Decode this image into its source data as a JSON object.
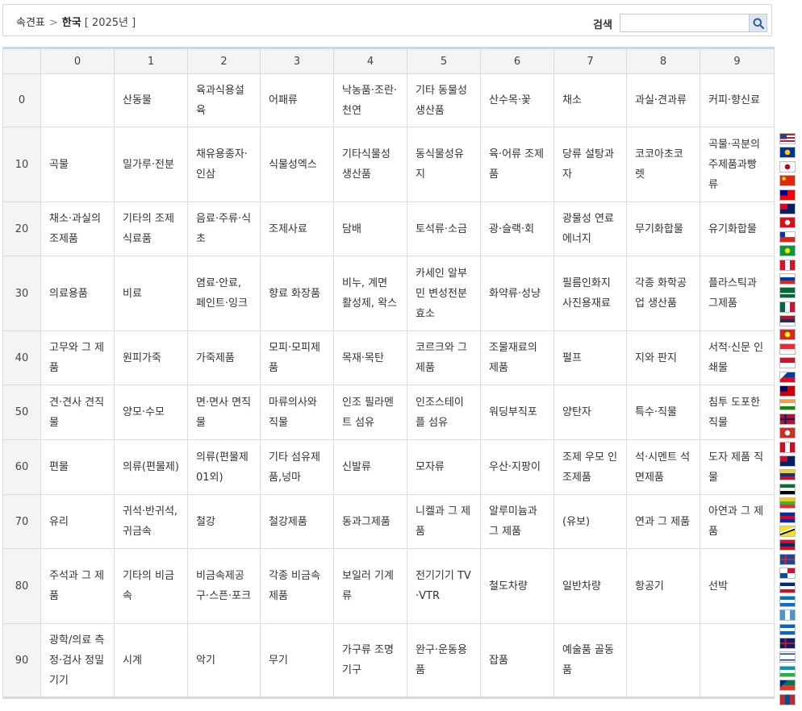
{
  "breadcrumb": {
    "root": "속견표",
    "separator": ">",
    "country": "한국",
    "year": "[ 2025년 ]"
  },
  "search": {
    "label": "검색",
    "value": "",
    "placeholder": ""
  },
  "table": {
    "columns": [
      "0",
      "1",
      "2",
      "3",
      "4",
      "5",
      "6",
      "7",
      "8",
      "9"
    ],
    "rows": [
      {
        "label": "0",
        "cells": [
          "",
          "산동물",
          "육과식용설육",
          "어패류",
          "낙농품·조란·천연",
          "기타 동물성 생산품",
          "산수목·꽃",
          "채소",
          "과실·견과류",
          "커피·향신료"
        ]
      },
      {
        "label": "10",
        "cells": [
          "곡물",
          "밀가루·전분",
          "채유용종자·인삼",
          "식물성엑스",
          "기타식물성 생산품",
          "동식물성유지",
          "육·어류 조제품",
          "당류 설탕과자",
          "코코아초코렛",
          "곡물·곡분의 주제품과빵류"
        ]
      },
      {
        "label": "20",
        "cells": [
          "채소·과실의 조제품",
          "기타의 조제 식료품",
          "음료·주류·식초",
          "조제사료",
          "담배",
          "토석류·소금",
          "광·슬랙·회",
          "광물성 연료 에너지",
          "무기화합물",
          "유기화합물"
        ]
      },
      {
        "label": "30",
        "cells": [
          "의료용품",
          "비료",
          "염료·안료, 페인트·잉크",
          "향료 화장품",
          "비누, 계면 활성제, 왁스",
          "카세인 알부민 변성전분 효소",
          "화약류·성냥",
          "필름인화지 사진용재료",
          "각종 화학공업 생산품",
          "플라스틱과 그제품"
        ]
      },
      {
        "label": "40",
        "cells": [
          "고무와 그 제품",
          "원피가죽",
          "가죽제품",
          "모피·모피제품",
          "목재·목탄",
          "코르크와 그 제품",
          "조물재료의 제품",
          "펄프",
          "지와 판지",
          "서적·신문 인쇄물"
        ]
      },
      {
        "label": "50",
        "cells": [
          "견·견사 견직물",
          "양모·수모",
          "면·면사 면직물",
          "마류의사와 직물",
          "인조 필라멘트 섬유",
          "인조스테이플 섬유",
          "워딩부직포",
          "양탄자",
          "특수·직물",
          "침투 도포한 직물"
        ]
      },
      {
        "label": "60",
        "cells": [
          "편물",
          "의류(편물제)",
          "의류(편물제01외)",
          "기타 섬유제품,넝마",
          "신발류",
          "모자류",
          "우산·지팡이",
          "조제 우모 인조제품",
          "석·시멘트 석면제품",
          "도자 제품 직물"
        ]
      },
      {
        "label": "70",
        "cells": [
          "유리",
          "귀석·반귀석,귀금속",
          "철강",
          "철강제품",
          "동과그제품",
          "니켈과 그 제품",
          "알루미늄과 그 제품",
          "(유보)",
          "연과 그 제품",
          "아연과 그 제품"
        ]
      },
      {
        "label": "80",
        "cells": [
          "주석과 그 제품",
          "기타의 비금속",
          "비금속제공구·스픈·포크",
          "각종 비금속제품",
          "보일러 기계류",
          "전기기기 TV·VTR",
          "철도차량",
          "일반차량",
          "항공기",
          "선박"
        ]
      },
      {
        "label": "90",
        "cells": [
          "광학/의료 측정·검사 정밀기기",
          "시계",
          "악기",
          "무기",
          "가구류 조명기구",
          "완구·운동용품",
          "잡품",
          "예술품 골동품",
          "",
          ""
        ]
      }
    ]
  },
  "flags": [
    {
      "name": "us-flag",
      "c1": "#b22234",
      "c2": "#ffffff",
      "c3": "#3c3b6e",
      "pat": "us"
    },
    {
      "name": "eu-flag",
      "c1": "#003399",
      "c2": "#003399",
      "c3": "#ffcc00",
      "pat": "dot"
    },
    {
      "name": "jp-flag",
      "c1": "#ffffff",
      "c2": "#ffffff",
      "c3": "#bc002d",
      "pat": "dot"
    },
    {
      "name": "cn-flag",
      "c1": "#de2910",
      "c2": "#de2910",
      "c3": "#ffde00",
      "pat": "corner"
    },
    {
      "name": "tw-flag",
      "c1": "#fe0000",
      "c2": "#fe0000",
      "c3": "#000095",
      "pat": "canton"
    },
    {
      "name": "au-flag",
      "c1": "#012169",
      "c2": "#012169",
      "c3": "#e4002b",
      "pat": "canton"
    },
    {
      "name": "tr-flag",
      "c1": "#e30a17",
      "c2": "#e30a17",
      "c3": "#ffffff",
      "pat": "dot"
    },
    {
      "name": "cl-flag",
      "c1": "#ffffff",
      "c2": "#d52b1e",
      "c3": "#0039a6",
      "pat": "hcanton"
    },
    {
      "name": "br-flag",
      "c1": "#009c3b",
      "c2": "#009c3b",
      "c3": "#ffdf00",
      "pat": "dot"
    },
    {
      "name": "pe-flag",
      "c1": "#d91023",
      "c2": "#ffffff",
      "c3": "#d91023",
      "pat": "v3"
    },
    {
      "name": "ru-flag",
      "c1": "#ffffff",
      "c2": "#0039a6",
      "c3": "#d52b1e",
      "pat": "h3"
    },
    {
      "name": "sa-flag",
      "c1": "#006c35",
      "c2": "#006c35",
      "c3": "#ffffff",
      "pat": "bar"
    },
    {
      "name": "mx-flag",
      "c1": "#006847",
      "c2": "#ffffff",
      "c3": "#ce1126",
      "pat": "v3"
    },
    {
      "name": "th-flag",
      "c1": "#a51931",
      "c2": "#2d2a4a",
      "c3": "#f4f5f8",
      "pat": "h3"
    },
    {
      "name": "vn-flag",
      "c1": "#da251d",
      "c2": "#da251d",
      "c3": "#ffff00",
      "pat": "dot"
    },
    {
      "name": "sg-flag",
      "c1": "#ed2939",
      "c2": "#ffffff",
      "c3": "#ffffff",
      "pat": "h2"
    },
    {
      "name": "id-flag",
      "c1": "#ce1126",
      "c2": "#ffffff",
      "c3": "#ffffff",
      "pat": "h2"
    },
    {
      "name": "ph-flag",
      "c1": "#0038a8",
      "c2": "#ce1126",
      "c3": "#ffffff",
      "pat": "tri"
    },
    {
      "name": "my-flag",
      "c1": "#cc0001",
      "c2": "#ffffff",
      "c3": "#010066",
      "pat": "canton"
    },
    {
      "name": "in-flag",
      "c1": "#ff9933",
      "c2": "#ffffff",
      "c3": "#138808",
      "pat": "h3"
    },
    {
      "name": "no-flag",
      "c1": "#ba0c2f",
      "c2": "#ba0c2f",
      "c3": "#00205b",
      "pat": "cross"
    },
    {
      "name": "ch-flag",
      "c1": "#d52b1e",
      "c2": "#d52b1e",
      "c3": "#ffffff",
      "pat": "dot"
    },
    {
      "name": "ca-flag",
      "c1": "#d80621",
      "c2": "#ffffff",
      "c3": "#d80621",
      "pat": "v3"
    },
    {
      "name": "nz-flag",
      "c1": "#012169",
      "c2": "#012169",
      "c3": "#c8102e",
      "pat": "canton"
    },
    {
      "name": "co-flag",
      "c1": "#fcd116",
      "c2": "#003893",
      "c3": "#ce1126",
      "pat": "h3"
    },
    {
      "name": "ae-flag",
      "c1": "#00732f",
      "c2": "#ffffff",
      "c3": "#000000",
      "pat": "h3"
    },
    {
      "name": "mm-flag",
      "c1": "#fecb00",
      "c2": "#34b233",
      "c3": "#ea2839",
      "pat": "h3"
    },
    {
      "name": "kh-flag",
      "c1": "#032ea1",
      "c2": "#e00025",
      "c3": "#032ea1",
      "pat": "h3"
    },
    {
      "name": "bn-flag",
      "c1": "#f7e017",
      "c2": "#ffffff",
      "c3": "#000000",
      "pat": "diag"
    },
    {
      "name": "la-flag",
      "c1": "#ce1126",
      "c2": "#002868",
      "c3": "#ce1126",
      "pat": "h3"
    },
    {
      "name": "is-flag",
      "c1": "#02529c",
      "c2": "#02529c",
      "c3": "#dc1e35",
      "pat": "cross"
    },
    {
      "name": "pa-flag",
      "c1": "#ffffff",
      "c2": "#d21034",
      "c3": "#005293",
      "pat": "quad"
    },
    {
      "name": "cr-flag",
      "c1": "#002b7f",
      "c2": "#ffffff",
      "c3": "#ce1126",
      "pat": "h3"
    },
    {
      "name": "hn-flag",
      "c1": "#0073cf",
      "c2": "#ffffff",
      "c3": "#0073cf",
      "pat": "h3"
    },
    {
      "name": "gt-flag",
      "c1": "#4997d0",
      "c2": "#ffffff",
      "c3": "#4997d0",
      "pat": "v3"
    },
    {
      "name": "ni-flag",
      "c1": "#0067c6",
      "c2": "#ffffff",
      "c3": "#0067c6",
      "pat": "h3"
    },
    {
      "name": "gb-flag",
      "c1": "#012169",
      "c2": "#ffffff",
      "c3": "#c8102e",
      "pat": "cross"
    },
    {
      "name": "il-flag",
      "c1": "#ffffff",
      "c2": "#0038b8",
      "c3": "#0038b8",
      "pat": "bars"
    },
    {
      "name": "uz-flag",
      "c1": "#1eb53a",
      "c2": "#ffffff",
      "c3": "#0099b5",
      "pat": "h3r"
    },
    {
      "name": "za-flag",
      "c1": "#007a4d",
      "c2": "#de3831",
      "c3": "#002395",
      "pat": "tri"
    },
    {
      "name": "mn-flag",
      "c1": "#c4272f",
      "c2": "#015197",
      "c3": "#c4272f",
      "pat": "v3"
    }
  ]
}
